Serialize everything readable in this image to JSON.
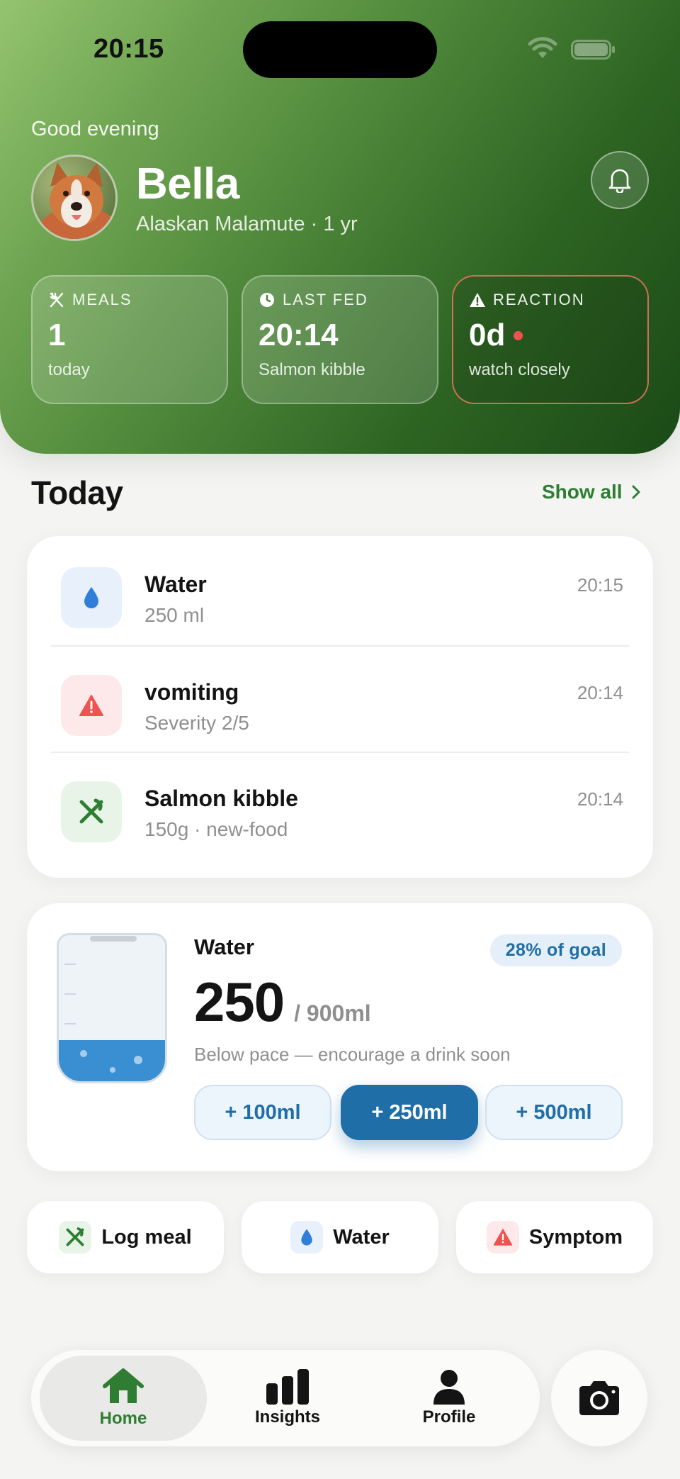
{
  "status_bar": {
    "time": "20:15"
  },
  "header": {
    "greeting": "Good evening",
    "pet_name": "Bella",
    "pet_meta": "Alaskan Malamute · 1 yr"
  },
  "stats": [
    {
      "label": "MEALS",
      "value": "1",
      "sub": "today",
      "icon": "fork-knife-icon"
    },
    {
      "label": "LAST FED",
      "value": "20:14",
      "sub": "Salmon kibble",
      "icon": "clock-icon"
    },
    {
      "label": "REACTION",
      "value": "0d",
      "sub": "watch closely",
      "icon": "warning-icon"
    }
  ],
  "today": {
    "title": "Today",
    "show_all": "Show all",
    "entries": [
      {
        "title": "Water",
        "sub": "250 ml",
        "time": "20:15",
        "icon": "water-drop-icon"
      },
      {
        "title": "vomiting",
        "sub": "Severity 2/5",
        "time": "20:14",
        "icon": "warning-icon"
      },
      {
        "title": "Salmon kibble",
        "sub": "150g · new-food",
        "time": "20:14",
        "icon": "fork-knife-icon"
      }
    ]
  },
  "water": {
    "title": "Water",
    "goal_badge": "28% of goal",
    "amount": "250",
    "goal": "/ 900ml",
    "hint": "Below pace — encourage a drink soon",
    "fill_fraction": 0.28,
    "buttons": [
      "+ 100ml",
      "+ 250ml",
      "+ 500ml"
    ],
    "colors": {
      "accent": "#1f6ea8",
      "fill": "#3a8fd3"
    }
  },
  "quick_actions": [
    {
      "label": "Log meal",
      "icon": "fork-knife-icon"
    },
    {
      "label": "Water",
      "icon": "water-drop-icon"
    },
    {
      "label": "Symptom",
      "icon": "warning-icon"
    }
  ],
  "tabs": [
    {
      "label": "Home",
      "icon": "home-icon",
      "active": true
    },
    {
      "label": "Insights",
      "icon": "bar-chart-icon",
      "active": false
    },
    {
      "label": "Profile",
      "icon": "person-icon",
      "active": false
    }
  ],
  "colors": {
    "brand_green": "#2e7d32",
    "alert_red": "#ef5350",
    "water_blue": "#1f6ea8"
  }
}
